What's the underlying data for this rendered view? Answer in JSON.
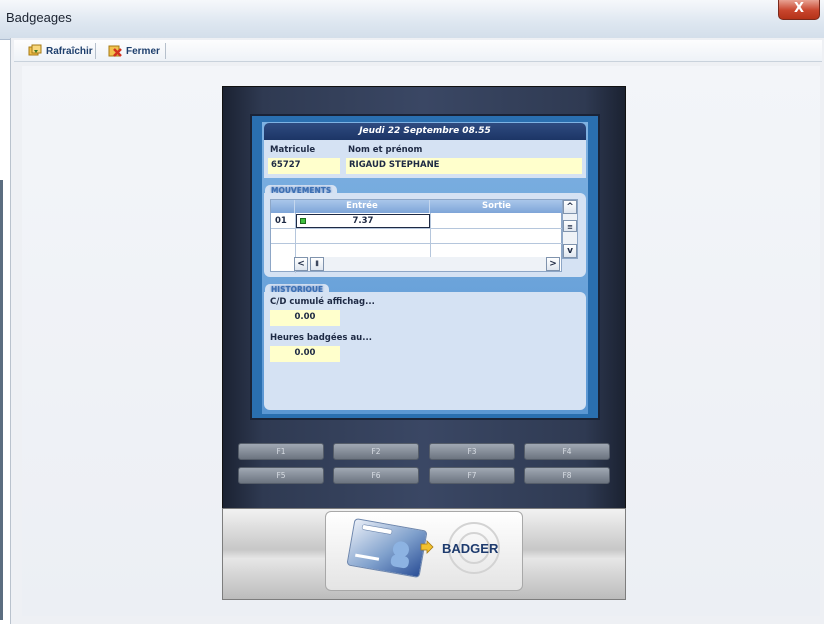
{
  "window": {
    "title": "Badgeages",
    "close_label": "X"
  },
  "toolbar": {
    "refresh_label": "Rafraîchir",
    "close_label": "Fermer"
  },
  "screen": {
    "date": "Jeudi 22 Septembre 08.55",
    "matricule_label": "Matricule",
    "matricule_value": "65727",
    "nom_label": "Nom et prénom",
    "nom_value": "RIGAUD STEPHANE",
    "mouvements": {
      "title": "MOUVEMENTS",
      "columns": [
        "Entrée",
        "Sortie"
      ],
      "rows": [
        {
          "num": "01",
          "entree": "7.37",
          "sortie": ""
        }
      ]
    },
    "historique": {
      "title": "HISTORIQUE",
      "cd_label": "C/D cumulé affichag...",
      "cd_value": "0.00",
      "heures_label": "Heures badgées au...",
      "heures_value": "0.00"
    }
  },
  "fkeys": [
    "F1",
    "F2",
    "F3",
    "F4",
    "F5",
    "F6",
    "F7",
    "F8"
  ],
  "badger": {
    "label": "BADGER"
  },
  "colors": {
    "accent": "#2a6fb0",
    "header": "#1c3566",
    "field": "#ffffcc"
  }
}
